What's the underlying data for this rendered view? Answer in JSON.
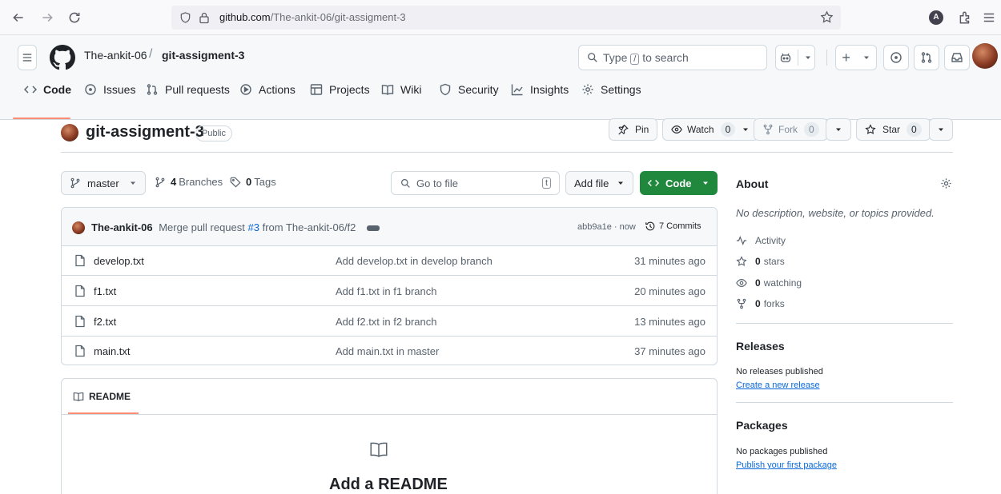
{
  "browser": {
    "url_host": "github.com",
    "url_path": "/The-ankit-06/git-assigment-3",
    "profile_initial": "A"
  },
  "header": {
    "owner": "The-ankit-06",
    "separator": "/",
    "repo": "git-assigment-3",
    "search_prefix": "Type",
    "search_key": "/",
    "search_suffix": "to search",
    "plus_label": "+"
  },
  "tabs": [
    {
      "label": "Code",
      "icon": "code-icon",
      "active": true
    },
    {
      "label": "Issues",
      "icon": "issue-icon"
    },
    {
      "label": "Pull requests",
      "icon": "pull-request-icon"
    },
    {
      "label": "Actions",
      "icon": "play-icon"
    },
    {
      "label": "Projects",
      "icon": "table-icon"
    },
    {
      "label": "Wiki",
      "icon": "book-icon"
    },
    {
      "label": "Security",
      "icon": "shield-icon"
    },
    {
      "label": "Insights",
      "icon": "graph-icon"
    },
    {
      "label": "Settings",
      "icon": "gear-icon"
    }
  ],
  "repo": {
    "title": "git-assigment-3",
    "visibility": "Public",
    "pin_label": "Pin",
    "watch_label": "Watch",
    "watch_count": "0",
    "fork_label": "Fork",
    "fork_count": "0",
    "star_label": "Star",
    "star_count": "0"
  },
  "toolbar": {
    "branch": "master",
    "branches_count": "4",
    "branches_label": "Branches",
    "tags_count": "0",
    "tags_label": "Tags",
    "goto_placeholder": "Go to file",
    "goto_key": "t",
    "add_file_label": "Add file",
    "code_label": "Code"
  },
  "commit": {
    "author": "The-ankit-06",
    "message_prefix": "Merge pull request",
    "pr_link": "#3",
    "message_suffix": "from The-ankit-06/f2",
    "sha_time": "abb9a1e · now",
    "commits_label": "7 Commits"
  },
  "files": [
    {
      "name": "develop.txt",
      "message": "Add develop.txt in develop branch",
      "time": "31 minutes ago"
    },
    {
      "name": "f1.txt",
      "message": "Add f1.txt in f1 branch",
      "time": "20 minutes ago"
    },
    {
      "name": "f2.txt",
      "message": "Add f2.txt in f2 branch",
      "time": "13 minutes ago"
    },
    {
      "name": "main.txt",
      "message": "Add main.txt in master",
      "time": "37 minutes ago"
    }
  ],
  "readme": {
    "tab_label": "README",
    "heading": "Add a README"
  },
  "about": {
    "heading": "About",
    "description": "No description, website, or topics provided.",
    "activity_label": "Activity",
    "stars_count": "0",
    "stars_label": "stars",
    "watching_count": "0",
    "watching_label": "watching",
    "forks_count": "0",
    "forks_label": "forks"
  },
  "releases": {
    "heading": "Releases",
    "empty_text": "No releases published",
    "link": "Create a new release"
  },
  "packages": {
    "heading": "Packages",
    "empty_text": "No packages published",
    "link": "Publish your first package"
  },
  "colors": {
    "accent_green": "#1f883d",
    "link_blue": "#0969da",
    "tab_underline": "#fd8c73"
  }
}
